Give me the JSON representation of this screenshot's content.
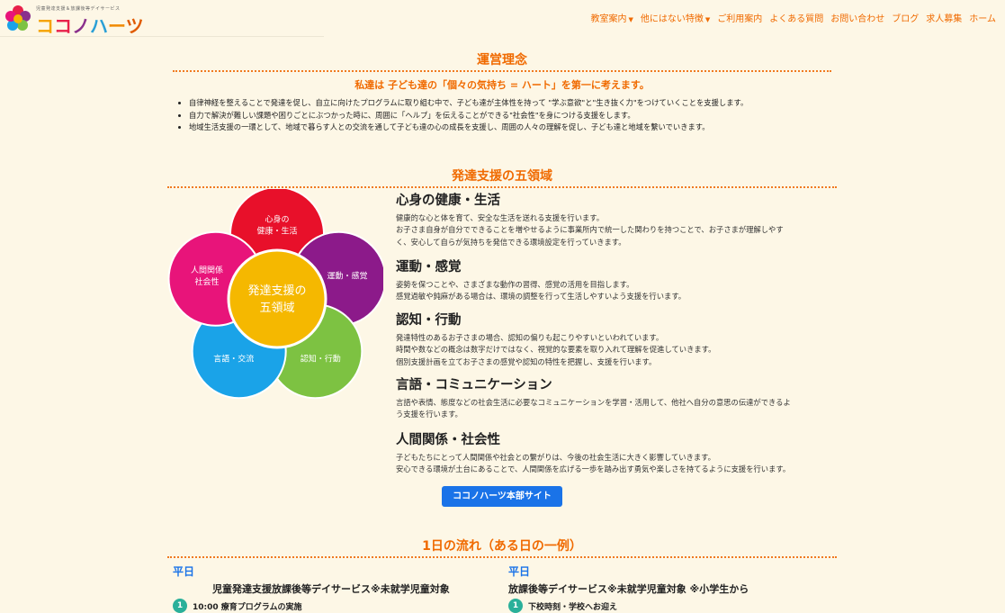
{
  "header": {
    "logo_tagline": "児童発達支援＆放課後等デイサービス",
    "logo_chars": [
      "コ",
      "コ",
      "ノ",
      "ハ",
      "ー",
      "ツ"
    ],
    "logo_colors": [
      "#f5a300",
      "#e8204a",
      "#8a2f8c",
      "#2a9fd6",
      "#f08a00",
      "#e05a00"
    ],
    "nav": [
      {
        "label": "教室案内",
        "dropdown": true
      },
      {
        "label": "他にはない特徴",
        "dropdown": true
      },
      {
        "label": "ご利用案内",
        "dropdown": false
      },
      {
        "label": "よくある質問",
        "dropdown": false
      },
      {
        "label": "お問い合わせ",
        "dropdown": false
      },
      {
        "label": "ブログ",
        "dropdown": false
      },
      {
        "label": "求人募集",
        "dropdown": false
      },
      {
        "label": "ホーム",
        "dropdown": false
      }
    ]
  },
  "philosophy": {
    "title": "運営理念",
    "mission": "私達は 子ども達の「個々の気持ち = ハート」を第一に考えます。",
    "bullets": [
      "自律神経を整えることで発達を促し、自立に向けたプログラムに取り組む中で、子ども達が主体性を持って \"学ぶ意欲\"と\"生き抜く力\"をつけていくことを支援します。",
      "自力で解決が難しい課題や困りごとにぶつかった時に、周囲に「ヘルプ」を伝えることができる\"社会性\"を身につける支援をします。",
      "地域生活支援の一環として、地域で暮らす人との交流を通して子ども達の心の成長を支援し、周囲の人々の理解を促し、子ども達と地域を繋いでいきます。"
    ]
  },
  "five_domains": {
    "title": "発達支援の五領域",
    "center": [
      "発達支援の",
      "五領域"
    ],
    "petals": [
      {
        "lines": [
          "心身の",
          "健康・生活"
        ],
        "color": "#e8102a"
      },
      {
        "lines": [
          "運動・感覚"
        ],
        "color": "#8c1a8a"
      },
      {
        "lines": [
          "認知・行動"
        ],
        "color": "#7dc242"
      },
      {
        "lines": [
          "言語・交流"
        ],
        "color": "#1aa3e8"
      },
      {
        "lines": [
          "人間関係",
          "社会性"
        ],
        "color": "#e8147a"
      }
    ],
    "center_color": "#f5b800",
    "items": [
      {
        "title": "心身の健康・生活",
        "lines": [
          "健康的な心と体を育て、安全な生活を送れる支援を行います。",
          "お子さま自身が自分でできることを増やせるように事業所内で統一した関わりを持つことで、お子さまが理解しやす",
          "く、安心して自らが気持ちを発信できる環境設定を行っていきます。"
        ]
      },
      {
        "title": "運動・感覚",
        "lines": [
          "姿勢を保つことや、さまざまな動作の習得、感覚の活用を目指します。",
          "感覚過敏や鈍麻がある場合は、環境の調整を行って生活しやすいよう支援を行います。"
        ]
      },
      {
        "title": "認知・行動",
        "lines": [
          "発達特性のあるお子さまの場合、認知の偏りも起こりやすいといわれています。",
          "時間や数などの概念は数字だけではなく、視覚的な要素を取り入れて理解を促進していきます。",
          "個別支援計画を立てお子さまの感覚や認知の特性を把握し、支援を行います。"
        ]
      },
      {
        "title": "言語・コミュニケーション",
        "lines": [
          "言語や表情、態度などの社会生活に必要なコミュニケーションを学習・活用して、他社へ自分の意思の伝達ができるよ",
          "う支援を行います。"
        ]
      },
      {
        "title": "人間関係・社会性",
        "lines": [
          "子どもたちにとって人間関係や社会との繋がりは、今後の社会生活に大きく影響していきます。",
          "安心できる環境が土台にあることで、人間関係を広げる一歩を踏み出す勇気や楽しさを持てるように支援を行います。"
        ]
      }
    ],
    "hq_button": "ココノハーツ本部サイト"
  },
  "daily_flow": {
    "title": "1日の流れ（ある日の一例）",
    "columns": [
      {
        "heading": "平日",
        "subtitle": "児童発達支援放課後等デイサービス※未就学児童対象",
        "first_step_num": "1",
        "first_step": "10:00 療育プログラムの実施"
      },
      {
        "heading": "平日",
        "subtitle": "放課後等デイサービス※未就学児童対象 ※小学生から",
        "first_step_num": "1",
        "first_step": "下校時刻・学校へお迎え"
      }
    ]
  }
}
